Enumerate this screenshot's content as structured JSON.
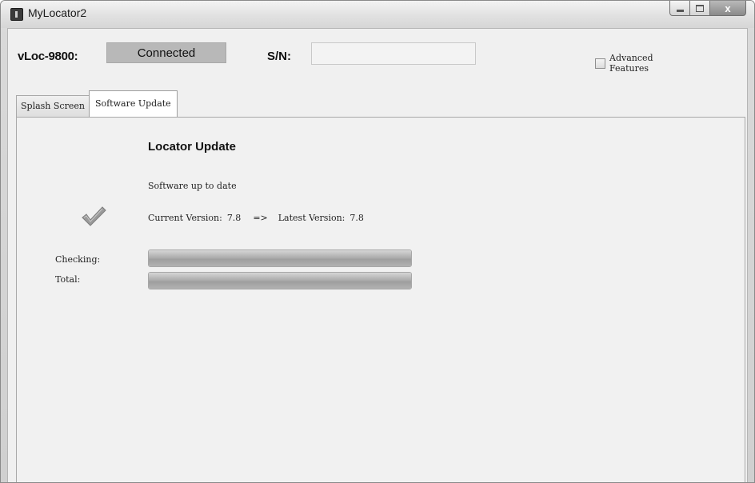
{
  "window": {
    "title": "MyLocator2",
    "controls": {
      "minimize_icon": "minimize-icon",
      "maximize_icon": "maximize-icon",
      "close_glyph": "x"
    }
  },
  "header": {
    "device_label": "vLoc-9800:",
    "connection_status": "Connected",
    "serial_label": "S/N:",
    "serial_value": "",
    "advanced_features_label": "Advanced Features",
    "advanced_features_checked": false
  },
  "tabs": [
    {
      "label": "Splash Screen",
      "active": false
    },
    {
      "label": "Software Update",
      "active": true
    }
  ],
  "update_panel": {
    "title": "Locator Update",
    "status": "Software up to date",
    "current_version_label": "Current Version:",
    "current_version": "7.8",
    "arrow": "=>",
    "latest_version_label": "Latest Version:",
    "latest_version": "7.8",
    "status_icon": "checkmark-icon",
    "checking_label": "Checking:",
    "checking_progress": 1.0,
    "total_label": "Total:",
    "total_progress": 1.0
  }
}
